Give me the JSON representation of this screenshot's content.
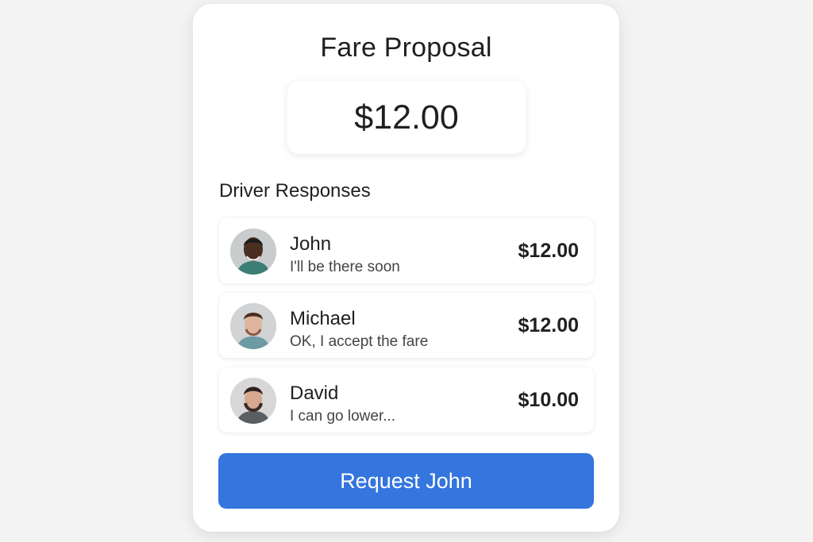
{
  "fare": {
    "title": "Fare Proposal",
    "amount": "$12.00"
  },
  "responses": {
    "heading": "Driver Responses",
    "items": [
      {
        "name": "John",
        "message": "I'll be there soon",
        "price": "$12.00",
        "avatar_icon": "driver-john-avatar"
      },
      {
        "name": "Michael",
        "message": "OK, I accept the fare",
        "price": "$12.00",
        "avatar_icon": "driver-michael-avatar"
      },
      {
        "name": "David",
        "message": "I can go lower...",
        "price": "$10.00",
        "avatar_icon": "driver-david-avatar"
      }
    ]
  },
  "action": {
    "request_label": "Request John"
  },
  "colors": {
    "accent": "#3475de",
    "background": "#f3f3f3",
    "card": "#ffffff"
  }
}
